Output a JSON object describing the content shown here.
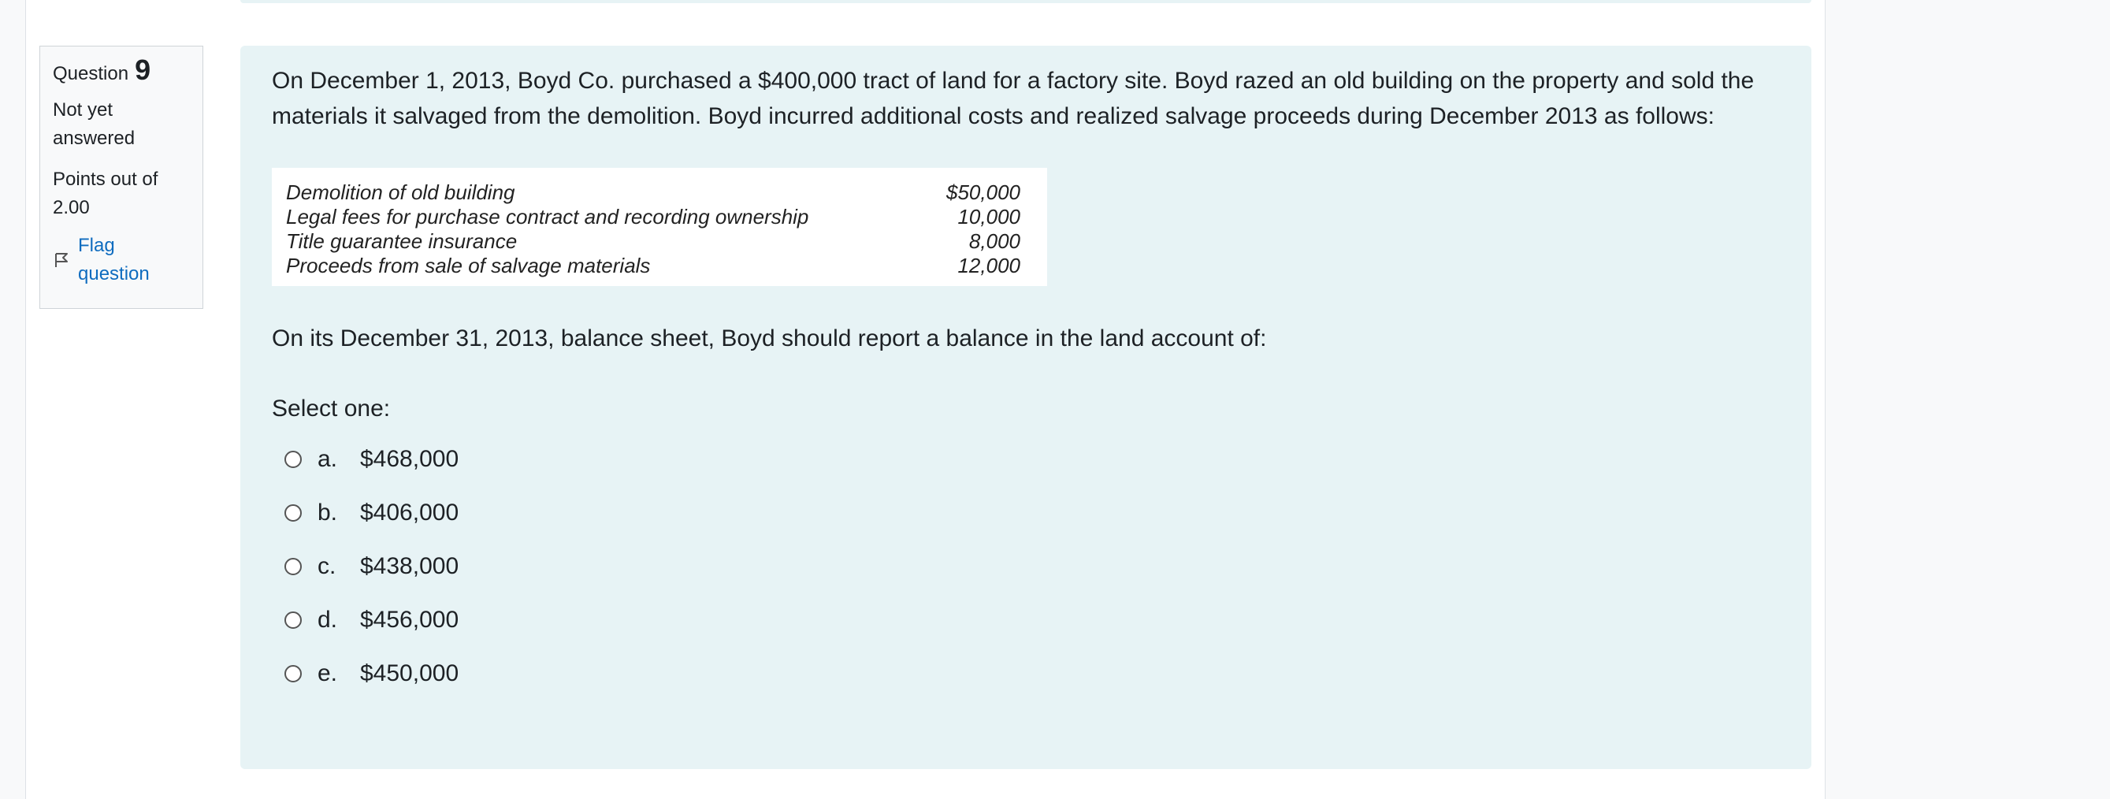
{
  "question_info": {
    "label": "Question",
    "number": "9",
    "state": "Not yet answered",
    "grade": "Points out of 2.00",
    "flag_label": "Flag question"
  },
  "question": {
    "text": "On December 1, 2013, Boyd Co. purchased a $400,000 tract of land for a factory site. Boyd razed an old building on the property and sold the materials it salvaged from the demolition. Boyd incurred additional costs and realized salvage proceeds during December 2013 as follows:",
    "table": [
      {
        "item": "Demolition of old building",
        "amount": "$50,000"
      },
      {
        "item": "Legal fees for purchase contract and recording ownership",
        "amount": "10,000"
      },
      {
        "item": "Title guarantee insurance",
        "amount": "8,000"
      },
      {
        "item": "Proceeds from sale of salvage materials",
        "amount": "12,000"
      }
    ],
    "prompt": "On its December 31, 2013, balance sheet, Boyd should report a balance in the land account of:",
    "select_label": "Select one:",
    "options": [
      {
        "letter": "a.",
        "value": "$468,000"
      },
      {
        "letter": "b.",
        "value": "$406,000"
      },
      {
        "letter": "c.",
        "value": "$438,000"
      },
      {
        "letter": "d.",
        "value": "$456,000"
      },
      {
        "letter": "e.",
        "value": "$450,000"
      }
    ]
  },
  "colors": {
    "content_bg": "#e7f3f5",
    "link": "#0f6cbf",
    "info_border": "#cfd4d8"
  }
}
